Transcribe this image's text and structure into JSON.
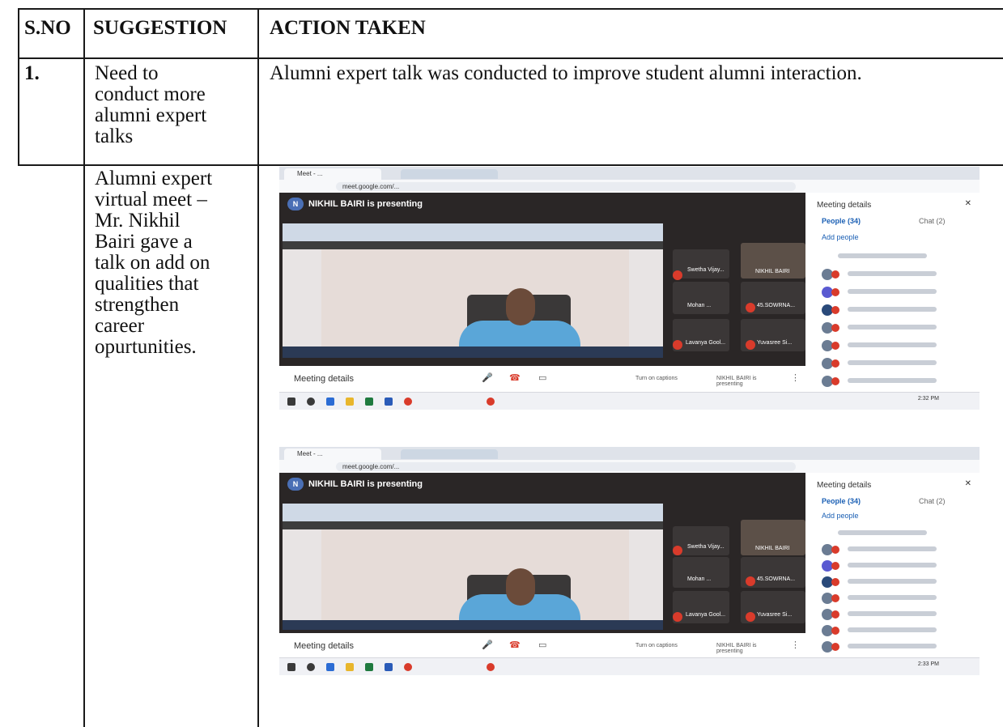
{
  "table": {
    "headers": {
      "sno": "S.NO",
      "suggestion": "SUGGESTION",
      "action": "ACTION TAKEN"
    },
    "row1": {
      "sno": "1.",
      "suggestion_lines": [
        "Need to",
        "conduct more",
        "alumni expert",
        "talks"
      ],
      "action": "Alumni expert talk was conducted to improve student alumni interaction."
    },
    "row2": {
      "suggestion_lines": [
        "Alumni expert",
        "virtual meet –",
        "Mr. Nikhil",
        "Bairi gave a",
        "talk on add on",
        "qualities that",
        "strengthen",
        "career",
        "opurtunities."
      ]
    }
  },
  "screenshots": [
    {
      "tab_title": "Meet - ...",
      "url": "meet.google.com/...",
      "presenting": "NIKHIL BAIRI is presenting",
      "avatar_letter": "N",
      "meeting_details": "Meeting details",
      "side_title": "Meeting details",
      "people_tab": "People (34)",
      "chat_tab": "Chat (2)",
      "add_people": "Add people",
      "tiles": [
        "Swetha Vijay...",
        "NIKHIL BAIRI",
        "Mohan ...",
        "45.SOWRNA...",
        "Lavanya Gool...",
        "Yuvasree Si..."
      ],
      "control_1": "Turn on captions",
      "control_2": "NIKHIL BAIRI is presenting",
      "clock": "2:32 PM"
    },
    {
      "tab_title": "Meet - ...",
      "url": "meet.google.com/...",
      "presenting": "NIKHIL BAIRI is presenting",
      "avatar_letter": "N",
      "meeting_details": "Meeting details",
      "side_title": "Meeting details",
      "people_tab": "People (34)",
      "chat_tab": "Chat (2)",
      "add_people": "Add people",
      "tiles": [
        "Swetha Vijay...",
        "NIKHIL BAIRI",
        "Mohan ...",
        "45.SOWRNA...",
        "Lavanya Gool...",
        "Yuvasree Si..."
      ],
      "control_1": "Turn on captions",
      "control_2": "NIKHIL BAIRI is presenting",
      "clock": "2:33 PM"
    }
  ]
}
